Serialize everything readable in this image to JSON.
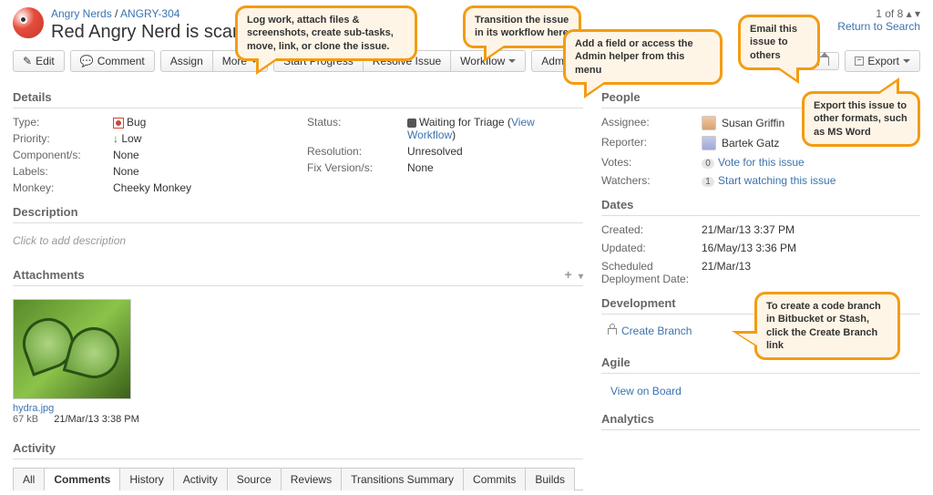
{
  "breadcrumb": {
    "project": "Angry Nerds",
    "sep": " / ",
    "key": "ANGRY-304"
  },
  "title": "Red Angry Nerd is scary",
  "pager": {
    "text": "1 of 8",
    "back": "Return to Search"
  },
  "toolbar": {
    "edit": "Edit",
    "comment": "Comment",
    "assign": "Assign",
    "more": "More",
    "start": "Start Progress",
    "resolve": "Resolve Issue",
    "workflow": "Workflow",
    "admin": "Admin",
    "export": "Export"
  },
  "sections": {
    "details": "Details",
    "description": "Description",
    "attachments": "Attachments",
    "activity": "Activity",
    "people": "People",
    "dates": "Dates",
    "development": "Development",
    "agile": "Agile",
    "analytics": "Analytics"
  },
  "details": {
    "type_l": "Type:",
    "type_v": "Bug",
    "priority_l": "Priority:",
    "priority_v": "Low",
    "components_l": "Component/s:",
    "components_v": "None",
    "labels_l": "Labels:",
    "labels_v": "None",
    "monkey_l": "Monkey:",
    "monkey_v": "Cheeky Monkey",
    "status_l": "Status:",
    "status_v": "Waiting for Triage",
    "status_link": "View Workflow",
    "resolution_l": "Resolution:",
    "resolution_v": "Unresolved",
    "fixv_l": "Fix Version/s:",
    "fixv_v": "None"
  },
  "description": {
    "empty": "Click to add description"
  },
  "attachment": {
    "name": "hydra.jpg",
    "size": "67 kB",
    "date": "21/Mar/13 3:38 PM"
  },
  "tabs": [
    "All",
    "Comments",
    "History",
    "Activity",
    "Source",
    "Reviews",
    "Transitions Summary",
    "Commits",
    "Builds"
  ],
  "people": {
    "assignee_l": "Assignee:",
    "assignee_v": "Susan Griffin",
    "reporter_l": "Reporter:",
    "reporter_v": "Bartek Gatz",
    "votes_l": "Votes:",
    "votes_badge": "0",
    "votes_link": "Vote for this issue",
    "watchers_l": "Watchers:",
    "watchers_badge": "1",
    "watchers_link": "Start watching this issue"
  },
  "dates": {
    "created_l": "Created:",
    "created_v": "21/Mar/13 3:37 PM",
    "updated_l": "Updated:",
    "updated_v": "16/May/13 3:36 PM",
    "sched_l": "Scheduled Deployment Date:",
    "sched_v": "21/Mar/13"
  },
  "development": {
    "link": "Create Branch"
  },
  "agile": {
    "link": "View on Board"
  },
  "callouts": {
    "more": "Log work, attach files & screenshots, create sub-tasks, move, link, or clone the issue.",
    "workflow": "Transition the issue in its workflow here",
    "admin": "Add a field or access the Admin helper from this menu",
    "share": "Email this issue to others",
    "export": "Export this issue to other formats, such as MS Word",
    "branch": "To create a code branch in Bitbucket or Stash, click the Create Branch link"
  }
}
